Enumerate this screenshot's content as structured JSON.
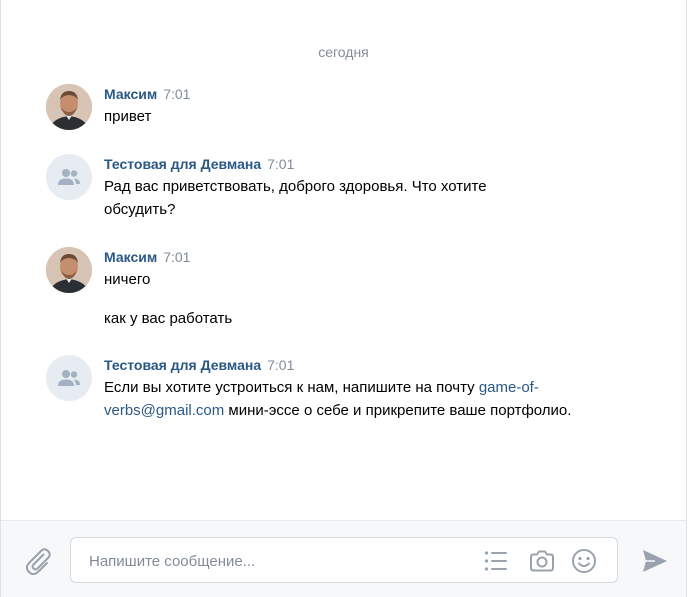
{
  "chat": {
    "date_divider": "сегодня",
    "messages": [
      {
        "author": "Максим",
        "avatar": "user-photo",
        "time": "7:01",
        "texts": [
          "привет"
        ]
      },
      {
        "author": "Тестовая для Девмана",
        "avatar": "community-icon",
        "time": "7:01",
        "texts": [
          "Рад вас приветствовать, доброго здоровья. Что хотите обсудить?"
        ]
      },
      {
        "author": "Максим",
        "avatar": "user-photo",
        "time": "7:01",
        "texts": [
          "ничего",
          "как у вас работать"
        ]
      },
      {
        "author": "Тестовая для Девмана",
        "avatar": "community-icon",
        "time": "7:01",
        "text_before_link": "Если вы хотите устроиться к нам, напишите на почту ",
        "link": "game-of-verbs@gmail.com",
        "text_after_link": " мини-эссе о себе и прикрепите ваше портфолио."
      }
    ]
  },
  "composer": {
    "placeholder": "Напишите сообщение...",
    "icons": [
      "paperclip-icon",
      "bot-keyboard-icon",
      "camera-icon",
      "emoji-icon",
      "send-icon"
    ]
  },
  "colors": {
    "author": "#2a5885",
    "meta": "#818c99",
    "link": "#2a5885",
    "icon": "#99a2ad",
    "composer_bg": "#f7f8fa"
  }
}
